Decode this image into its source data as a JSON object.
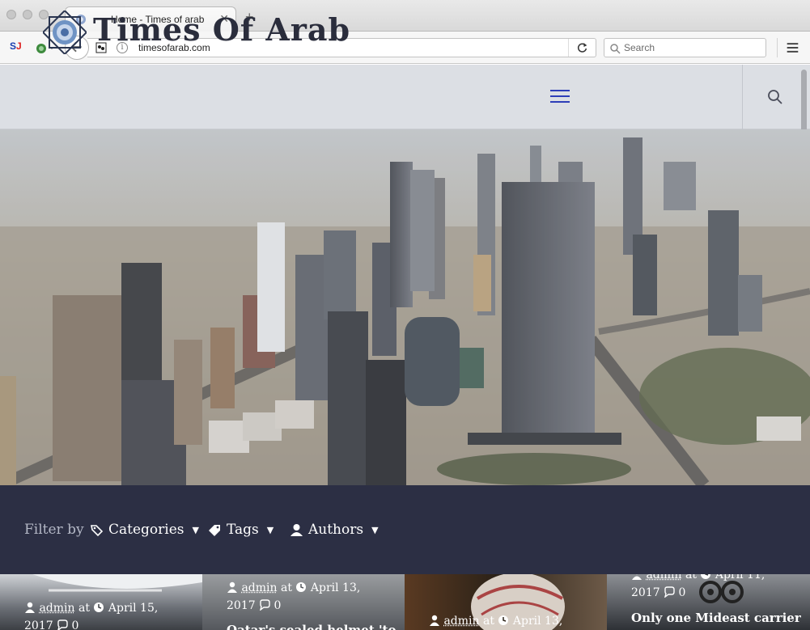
{
  "browser": {
    "tab_title": "Home - Times of arab",
    "url": "timesofarab.com",
    "search_placeholder": "Search",
    "extension_label": "S",
    "extension_label_accent": "J"
  },
  "site": {
    "name": "Times Of Arab"
  },
  "filter": {
    "label": "Filter by",
    "categories": "Categories",
    "tags": "Tags",
    "authors": "Authors",
    "caret": "▼"
  },
  "posts": [
    {
      "author": "admin",
      "at": "at",
      "date": "April 15,",
      "year": "2017",
      "comments": "0",
      "title": ""
    },
    {
      "author": "admin",
      "at": "at",
      "date": "April 13,",
      "year": "2017",
      "comments": "0",
      "title": "Qatar's sealed helmet 'to"
    },
    {
      "author": "admin",
      "at": "at",
      "date": "April 13,",
      "year": "",
      "comments": "",
      "title": ""
    },
    {
      "author": "admin",
      "at": "at",
      "date": "April 11,",
      "year": "2017",
      "comments": "0",
      "title": "Only one Mideast carrier"
    }
  ],
  "colors": {
    "header_bg": "#dcdfe4",
    "filter_bg": "#2c2f44",
    "accent_menu": "#2d3eb8",
    "brand_text": "#2a2d3c"
  }
}
